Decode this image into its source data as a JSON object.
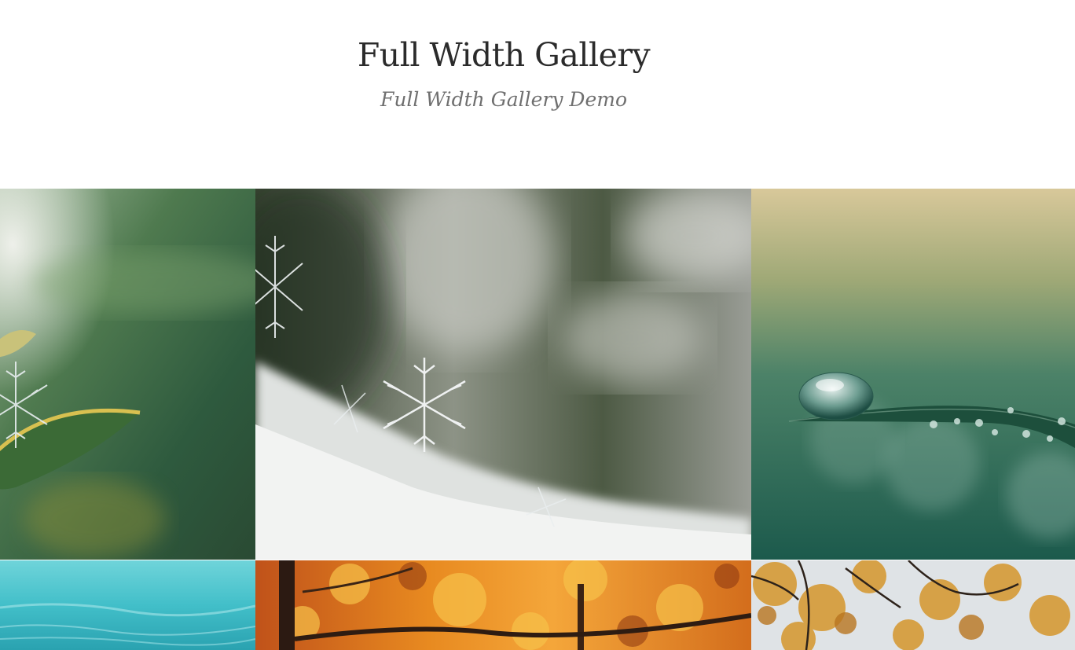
{
  "header": {
    "title": "Full Width Gallery",
    "tagline": "Full Width Gallery Demo"
  },
  "gallery": {
    "photos": [
      {
        "subject": "snowflake on green leaf",
        "accent": "#3f6a45"
      },
      {
        "subject": "snowflakes on snow close-up",
        "accent": "#b8bcb6"
      },
      {
        "subject": "water droplet on grass blade",
        "accent": "#2f6a55"
      },
      {
        "subject": "turquoise water",
        "accent": "#4fc6cf"
      },
      {
        "subject": "orange autumn trees",
        "accent": "#e08a1e"
      },
      {
        "subject": "golden autumn branches",
        "accent": "#c99640"
      }
    ]
  },
  "colors": {
    "title": "#2b2b2b",
    "tagline": "#6f6f6f",
    "background": "#ffffff"
  }
}
